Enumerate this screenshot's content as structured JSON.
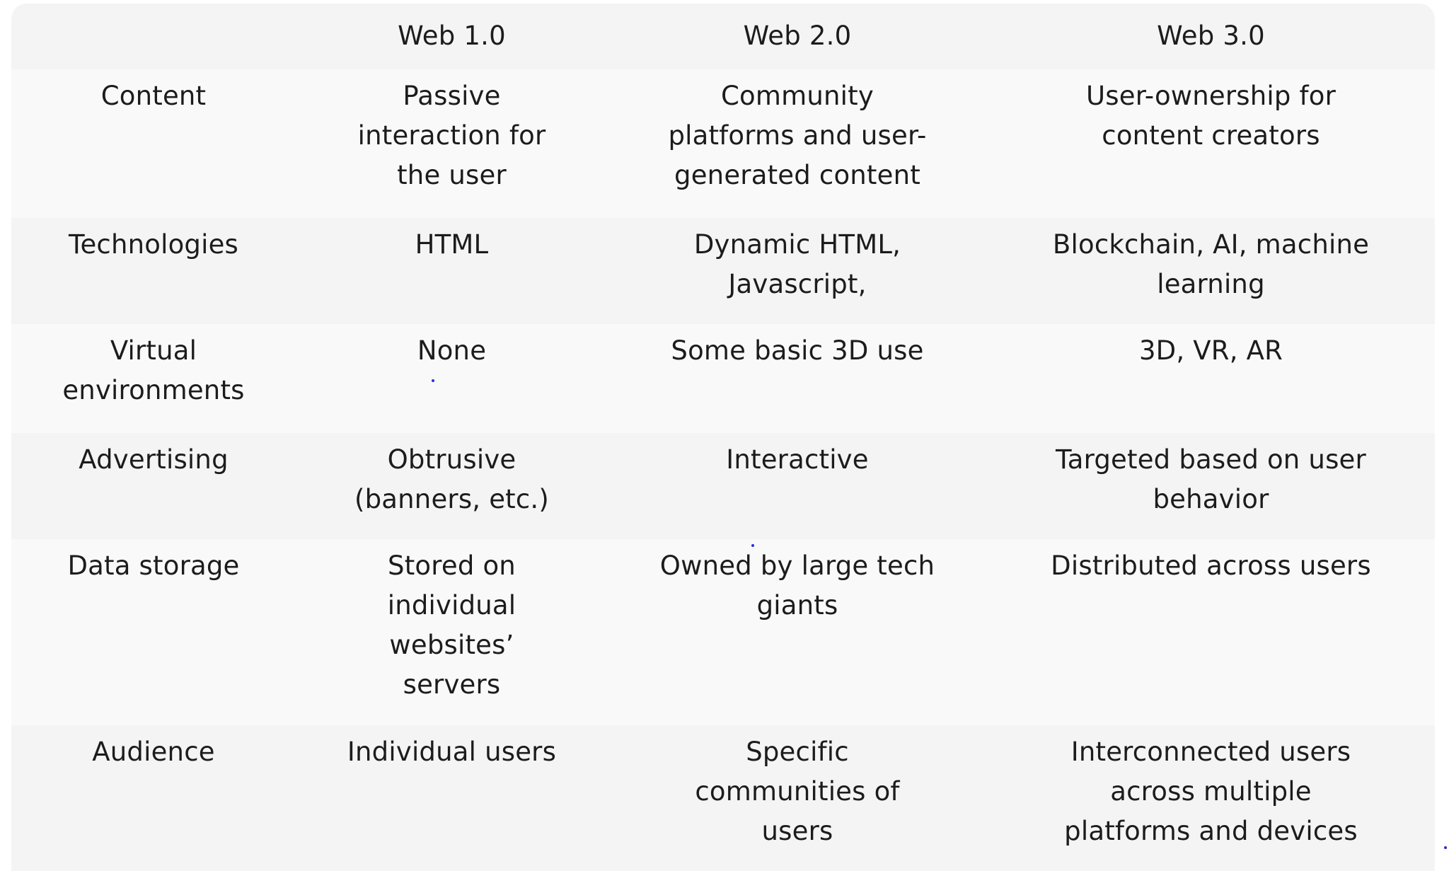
{
  "table": {
    "headers": [
      "",
      "Web 1.0",
      "Web 2.0",
      "Web 3.0"
    ],
    "rows": [
      {
        "label": "Content",
        "web1": "Passive\ninteraction for\nthe user",
        "web2": "Community\nplatforms and user-\ngenerated content",
        "web3": "User-ownership for\ncontent creators"
      },
      {
        "label": "Technologies",
        "web1": "HTML",
        "web2": "Dynamic HTML,\nJavascript,",
        "web3": "Blockchain, AI, machine\nlearning"
      },
      {
        "label": "Virtual\nenvironments",
        "web1": "None",
        "web2": "Some basic 3D use",
        "web3": "3D, VR, AR"
      },
      {
        "label": "Advertising",
        "web1": "Obtrusive\n(banners, etc.)",
        "web2": "Interactive",
        "web3": "Targeted based on user\nbehavior"
      },
      {
        "label": "Data storage",
        "web1": "Stored on\nindividual\nwebsites’\nservers",
        "web2": "Owned by large tech\ngiants",
        "web3": "Distributed across users"
      },
      {
        "label": "Audience",
        "web1": "Individual users",
        "web2": "Specific\ncommunities of\nusers",
        "web3": "Interconnected users\nacross multiple\nplatforms and devices"
      }
    ]
  },
  "colors": {
    "header_bg": "#f4f4f4",
    "row_odd_bg": "#f9f9f9",
    "row_even_bg": "#f4f4f4",
    "text": "#1c1c1c"
  }
}
